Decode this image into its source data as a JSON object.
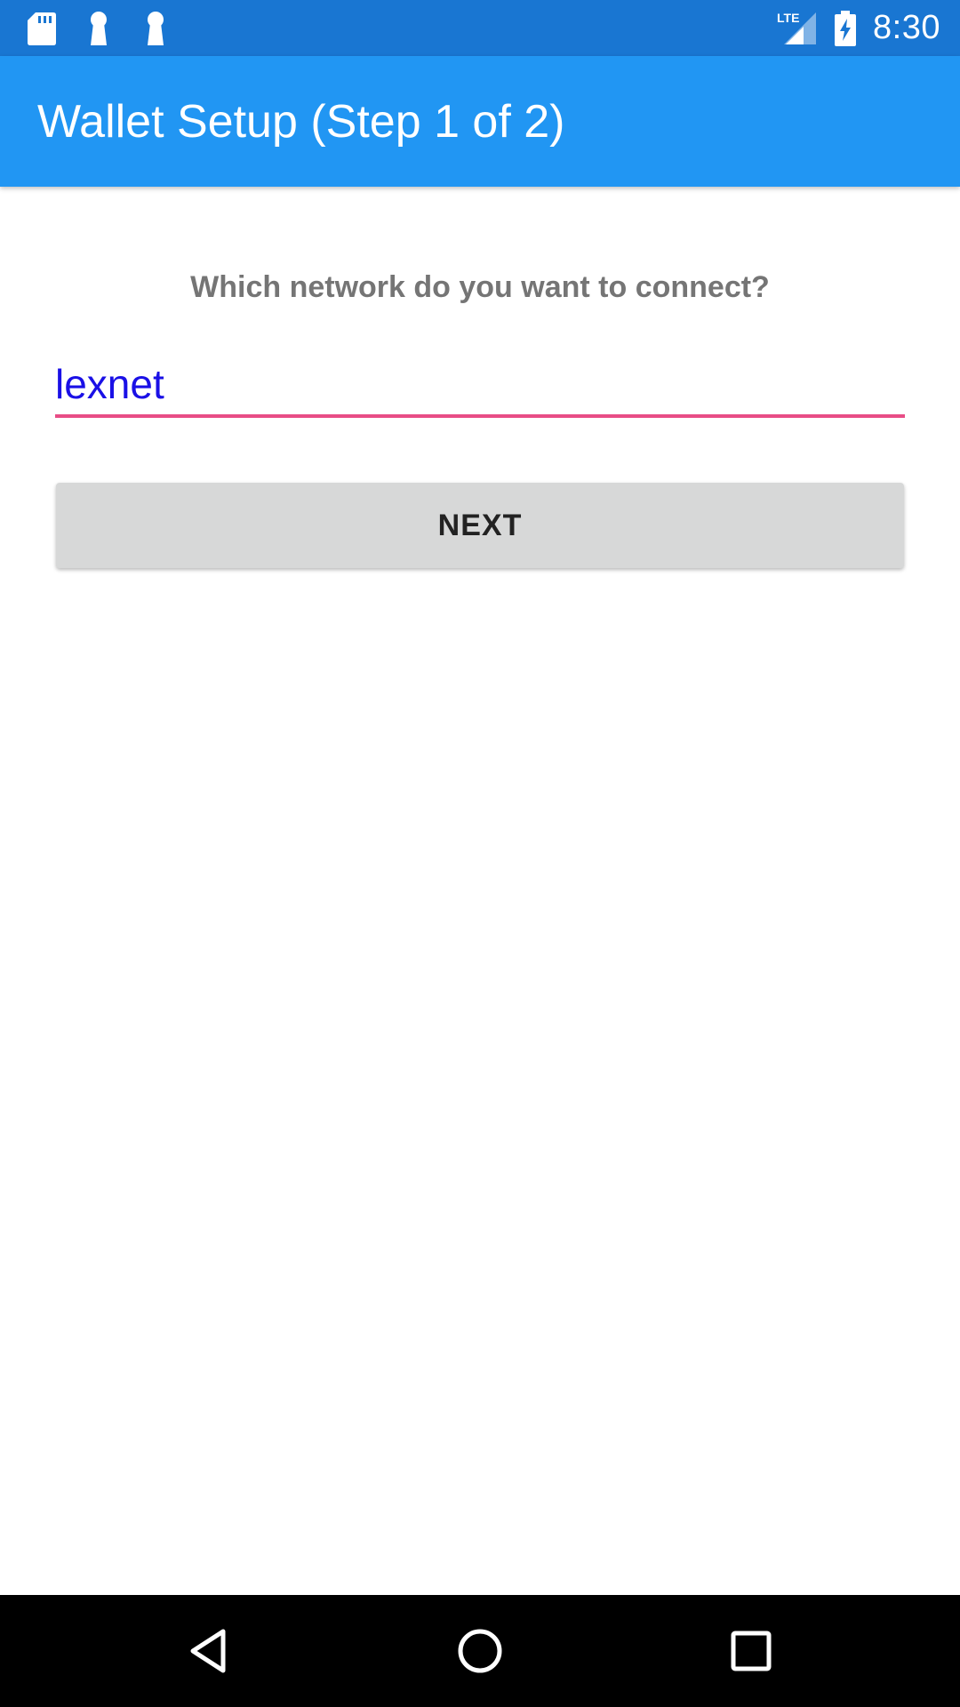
{
  "status_bar": {
    "time": "8:30",
    "network_label": "LTE",
    "icons": [
      "sd-card-icon",
      "keyhole-icon",
      "keyhole-icon",
      "lte-signal-icon",
      "battery-charging-icon"
    ]
  },
  "app_bar": {
    "title": "Wallet Setup (Step 1 of 2)"
  },
  "form": {
    "question": "Which network do you want to connect?",
    "network_value": "lexnet",
    "next_label": "NEXT"
  },
  "nav_bar": {
    "icons": [
      "back-icon",
      "home-icon",
      "recents-icon"
    ]
  },
  "colors": {
    "status_bar": "#1976d2",
    "app_bar": "#2196f3",
    "input_underline": "#e84d86",
    "input_text": "#1a10e6",
    "button_bg": "#d7d8d8",
    "question_text": "#757575"
  }
}
